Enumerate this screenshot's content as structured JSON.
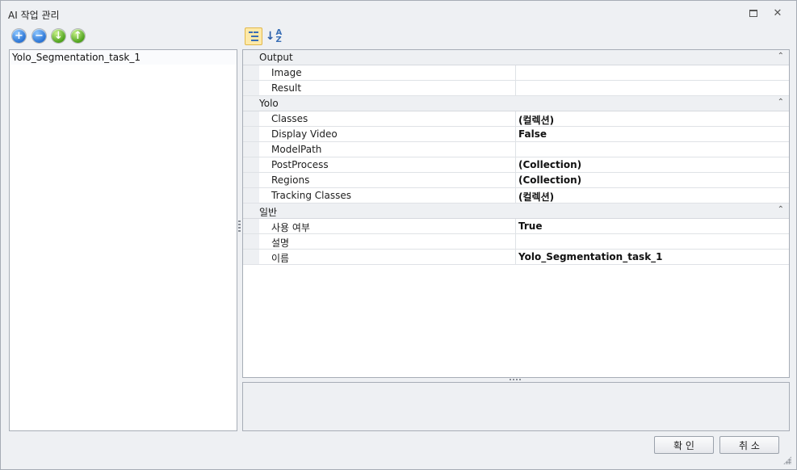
{
  "window": {
    "title": "AI 작업 관리"
  },
  "toolbar": {
    "add": "+",
    "remove": "−",
    "down": "↓",
    "up": "↑"
  },
  "task_list": {
    "items": [
      "Yolo_Segmentation_task_1"
    ]
  },
  "property_grid": {
    "categories": [
      {
        "name": "Output",
        "toggle": "⌃",
        "props": [
          {
            "name": "Image",
            "value": ""
          },
          {
            "name": "Result",
            "value": ""
          }
        ]
      },
      {
        "name": "Yolo",
        "toggle": "⌃",
        "props": [
          {
            "name": "Classes",
            "value": "(컬렉션)"
          },
          {
            "name": "Display Video",
            "value": "False"
          },
          {
            "name": "ModelPath",
            "value": ""
          },
          {
            "name": "PostProcess",
            "value": "(Collection)"
          },
          {
            "name": "Regions",
            "value": "(Collection)"
          },
          {
            "name": "Tracking Classes",
            "value": "(컬렉션)"
          }
        ]
      },
      {
        "name": "일반",
        "toggle": "⌃",
        "props": [
          {
            "name": "사용 여부",
            "value": "True"
          },
          {
            "name": "설명",
            "value": ""
          },
          {
            "name": "이름",
            "value": "Yolo_Segmentation_task_1"
          }
        ]
      }
    ]
  },
  "buttons": {
    "ok": "확 인",
    "cancel": "취 소"
  },
  "title_buttons": {
    "close": "✕"
  },
  "sort_icon": {
    "a": "A",
    "z": "Z",
    "arrow": "↓"
  }
}
